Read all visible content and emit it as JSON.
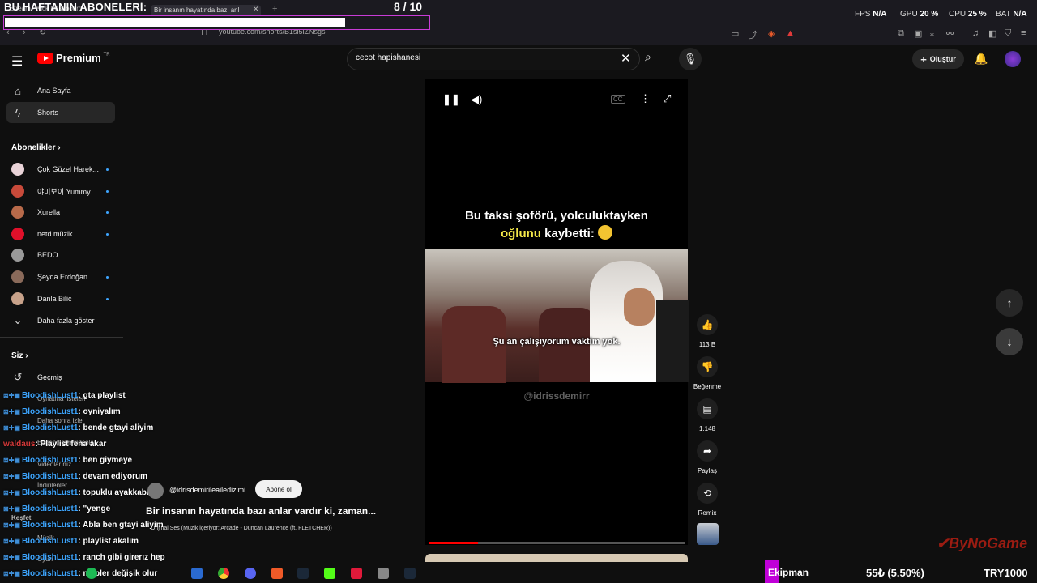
{
  "overlay": {
    "title": "BU HAFTANIN ABONELERİ:",
    "count": "8 / 10"
  },
  "browser": {
    "tab1": "Stream - Kick Dashboard",
    "tab2": "Bir insanın hayatında bazı anl",
    "address": "youtube.com/shorts/B1si5iZNsgs"
  },
  "stats": {
    "fps_label": "FPS",
    "fps_value": "N/A",
    "gpu_label": "GPU",
    "gpu_value": "20 %",
    "cpu_label": "CPU",
    "cpu_value": "25 %",
    "bat_label": "BAT",
    "bat_value": "N/A"
  },
  "header": {
    "logo_text": "Premium",
    "logo_sup": "TR",
    "search_value": "cecot hapishanesi",
    "create_label": "Oluştur"
  },
  "sidebar": {
    "home": "Ana Sayfa",
    "shorts": "Shorts",
    "subs_heading": "Abonelikler",
    "subs": [
      "Çok Güzel Harek...",
      "야미보이 Yummy...",
      "Xurella",
      "netd müzik",
      "BEDO",
      "Şeyda Erdoğan",
      "Danla Bilic"
    ],
    "more": "Daha fazla göster",
    "you_heading": "Siz",
    "history": "Geçmiş",
    "playlists": "Oynatma listeleri",
    "watch_later": "Daha sonra izle",
    "liked": "Beğendiğim videolar",
    "your_videos": "Videolarınız",
    "downloads": "İndirilenler",
    "explore": "Keşfet",
    "music": "Müzik",
    "game": "Oyun"
  },
  "chat": [
    {
      "user": "BloodishLust1",
      "msg": ": gta playlist"
    },
    {
      "user": "BloodishLust1",
      "msg": ": oyniyalım"
    },
    {
      "user": "BloodishLust1",
      "msg": ": bende gtayi aliyim"
    },
    {
      "user": "waldaus",
      "msg": ": Playlist fena akar"
    },
    {
      "user": "BloodishLust1",
      "msg": ": ben giymeye"
    },
    {
      "user": "BloodishLust1",
      "msg": ": devam ediyorum"
    },
    {
      "user": "BloodishLust1",
      "msg": ": topuklu ayakkabıyı"
    },
    {
      "user": "BloodishLust1",
      "msg": ": \"yenge"
    },
    {
      "user": "BloodishLust1",
      "msg": ": Abla ben gtayi aliyim"
    },
    {
      "user": "BloodishLust1",
      "msg": ": playlist akalım"
    },
    {
      "user": "BloodishLust1",
      "msg": ": ranch gibi girerız hep"
    },
    {
      "user": "BloodishLust1",
      "msg": ": mapler değişik olur"
    }
  ],
  "video": {
    "caption_line1": "Bu taksi şoförü, yolculuktayken",
    "caption_hl": "oğlunu",
    "caption_rest": "kaybetti:",
    "subtitle": "Şu an çalışıyorum vaktim yok.",
    "watermark": "@idrissdemirr",
    "channel": "@idrisdemirileailedizimi",
    "subscribe": "Abone ol",
    "title": "Bir insanın hayatında bazı anlar vardır ki, zaman...",
    "music": "Orijinal Ses (Müzik içeriyor: Arcade - Duncan Laurence (ft. FLETCHER))",
    "cc": "CC"
  },
  "actions": {
    "likes": "113 B",
    "dislike_label": "Beğenme",
    "comments": "1.148",
    "share": "Paylaş",
    "remix": "Remix"
  },
  "bottom": {
    "brand": "ByNoGame",
    "ekipman": "Ekipman",
    "ticker1": "55₺ (5.50%)",
    "ticker2": "TRY1000"
  },
  "colors": {
    "accent_red": "#ff0000",
    "overlay_border": "#c83cd6",
    "caption_highlight": "#f5e94a",
    "link_blue": "#3ea6ff"
  }
}
